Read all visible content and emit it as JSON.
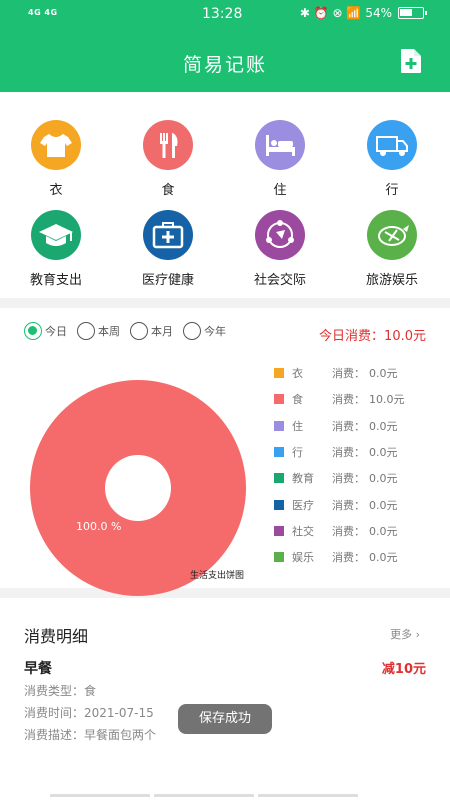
{
  "status_bar": {
    "signal": "4G  4G",
    "time": "13:28",
    "indicators": "✱ ⏰ ⊗  📶",
    "battery": "54%"
  },
  "header": {
    "title": "简易记账",
    "add_icon": "add-file-icon"
  },
  "categories": [
    {
      "label": "衣",
      "color": "#f5a623",
      "icon": "tshirt-icon"
    },
    {
      "label": "食",
      "color": "#f06b6b",
      "icon": "fork-knife-icon"
    },
    {
      "label": "住",
      "color": "#9b8de0",
      "icon": "bed-icon"
    },
    {
      "label": "行",
      "color": "#3aa0f0",
      "icon": "truck-icon"
    },
    {
      "label": "教育支出",
      "color": "#1aa870",
      "icon": "graduation-cap-icon"
    },
    {
      "label": "医疗健康",
      "color": "#1562a6",
      "icon": "medical-kit-icon"
    },
    {
      "label": "社会交际",
      "color": "#9b4aa0",
      "icon": "social-network-icon"
    },
    {
      "label": "旅游娱乐",
      "color": "#5ab14a",
      "icon": "travel-icon"
    }
  ],
  "period_options": [
    {
      "label": "今日",
      "selected": true
    },
    {
      "label": "本周",
      "selected": false
    },
    {
      "label": "本月",
      "selected": false
    },
    {
      "label": "今年",
      "selected": false
    }
  ],
  "today_spend": "今日消费：10.0元",
  "chart_data": {
    "type": "pie",
    "title": "生活支出饼图",
    "slice_label": "100.0 %",
    "series": [
      {
        "name": "衣",
        "value": 0.0,
        "color": "#f5a623"
      },
      {
        "name": "食",
        "value": 10.0,
        "color": "#f56b6b"
      },
      {
        "name": "住",
        "value": 0.0,
        "color": "#9b8de0"
      },
      {
        "name": "行",
        "value": 0.0,
        "color": "#3aa0f0"
      },
      {
        "name": "教育",
        "value": 0.0,
        "color": "#1aa870"
      },
      {
        "name": "医疗",
        "value": 0.0,
        "color": "#1562a6"
      },
      {
        "name": "社交",
        "value": 0.0,
        "color": "#9b4aa0"
      },
      {
        "name": "娱乐",
        "value": 0.0,
        "color": "#5ab14a"
      }
    ],
    "legend_prefix": "消费：",
    "legend_values": [
      "0.0元",
      "10.0元",
      "0.0元",
      "0.0元",
      "0.0元",
      "0.0元",
      "0.0元",
      "0.0元"
    ]
  },
  "detail": {
    "heading": "消费明细",
    "more": "更多",
    "item_name": "早餐",
    "amount": "减10元",
    "type_line": "消费类型：食",
    "time_line": "消费时间：2021-07-15",
    "desc_line": "消费描述：早餐面包两个"
  },
  "toast": "保存成功"
}
